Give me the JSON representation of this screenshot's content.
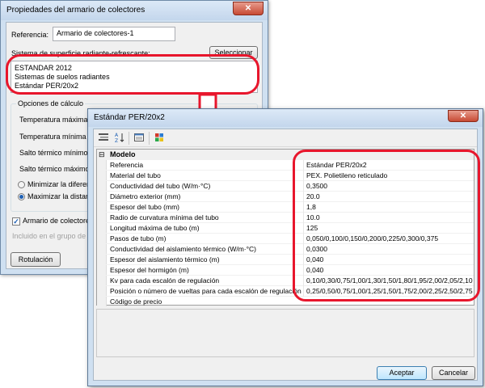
{
  "back_dialog": {
    "title": "Propiedades del armario de colectores",
    "close_glyph": "✕",
    "referencia_label": "Referencia:",
    "referencia_value": "Armario de colectores-1",
    "sistema_label": "Sistema de superficie radiante-refrescante:",
    "seleccionar_label": "Seleccionar",
    "sistema_lines": [
      "ESTANDAR 2012",
      "Sistemas de suelos radiantes",
      "Estándar PER/20x2"
    ],
    "opciones_label": "Opciones de cálculo",
    "options": [
      "Temperatura máxima de",
      "Temperatura mínima de",
      "Salto térmico mínimo en",
      "Salto térmico máximo en"
    ],
    "radios": [
      {
        "label": "Minimizar la diferencia",
        "selected": false
      },
      {
        "label": "Maximizar la distancia",
        "selected": true
      }
    ],
    "checkbox_label": "Armario de colectores c",
    "checkbox_checked": true,
    "grupo_text": "Incluido en el grupo de arm",
    "rotulacion_label": "Rotulación"
  },
  "front_dialog": {
    "title": "Estándar PER/20x2",
    "close_glyph": "✕",
    "toolbar_icons": [
      "categorized-icon",
      "sort-az-icon",
      "property-pages-icon",
      "palette-icon"
    ],
    "category": {
      "expand_glyph": "⊟",
      "label": "Modelo"
    },
    "properties": [
      {
        "name": "Referencia",
        "value": "Estándar PER/20x2"
      },
      {
        "name": "Material del tubo",
        "value": "PEX. Polietileno reticulado"
      },
      {
        "name": "Conductividad del tubo (W/m·°C)",
        "value": "0,3500"
      },
      {
        "name": "Diámetro exterior (mm)",
        "value": "20.0"
      },
      {
        "name": "Espesor del tubo (mm)",
        "value": "1,8"
      },
      {
        "name": "Radio de curvatura mínima del tubo",
        "value": "10.0"
      },
      {
        "name": "Longitud máxima de tubo (m)",
        "value": "125"
      },
      {
        "name": "Pasos de tubo (m)",
        "value": "0,050/0,100/0,150/0,200/0,225/0,300/0,375"
      },
      {
        "name": "Conductividad del aislamiento térmico (W/m·°C)",
        "value": "0,0300"
      },
      {
        "name": "Espesor del aislamiento térmico (m)",
        "value": "0,040"
      },
      {
        "name": "Espesor del hormigón (m)",
        "value": "0,040"
      },
      {
        "name": "Kv para cada escalón de regulación",
        "value": "0,10/0,30/0,75/1,00/1,30/1,50/1,80/1,95/2,00/2,05/2,10"
      },
      {
        "name": "Posición o número de vueltas para cada escalón de regulación",
        "value": "0,25/0,50/0,75/1,00/1,25/1,50/1,75/2,00/2,25/2,50/2,75"
      },
      {
        "name": "Código de precio",
        "value": ""
      }
    ],
    "aceptar_label": "Aceptar",
    "cancelar_label": "Cancelar"
  },
  "annotation_color": "#e8162c"
}
